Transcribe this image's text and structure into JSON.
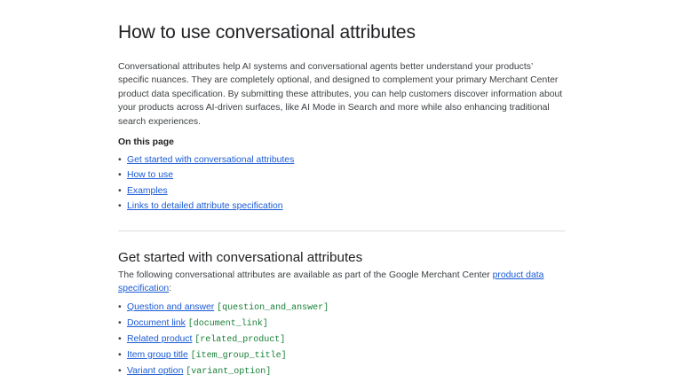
{
  "page": {
    "title": "How to use conversational attributes",
    "intro": "Conversational attributes help AI systems and conversational agents better understand your products’ specific nuances. They are completely optional, and designed to complement your primary Merchant Center product data specification. By submitting these attributes, you can help customers discover information about your products across AI-driven surfaces, like AI Mode in Search and more while also enhancing traditional search experiences."
  },
  "toc": {
    "heading": "On this page",
    "items": [
      {
        "label": "Get started with conversational attributes"
      },
      {
        "label": "How to use"
      },
      {
        "label": "Examples"
      },
      {
        "label": "Links to detailed attribute specification"
      }
    ]
  },
  "section": {
    "heading": "Get started with conversational attributes",
    "intro_before": "The following conversational attributes are available as part of the Google Merchant Center ",
    "intro_link": "product data specification",
    "intro_after": ":",
    "attributes": [
      {
        "label": "Question and answer",
        "code": "[question_and_answer]"
      },
      {
        "label": "Document link",
        "code": "[document_link]"
      },
      {
        "label": "Related product",
        "code": "[related_product]"
      },
      {
        "label": "Item group title",
        "code": "[item_group_title]"
      },
      {
        "label": "Variant option",
        "code": "[variant_option]"
      }
    ]
  },
  "colors": {
    "text": "#202124",
    "link": "#1a5bd6",
    "code": "#188038",
    "divider": "#dadce0"
  }
}
